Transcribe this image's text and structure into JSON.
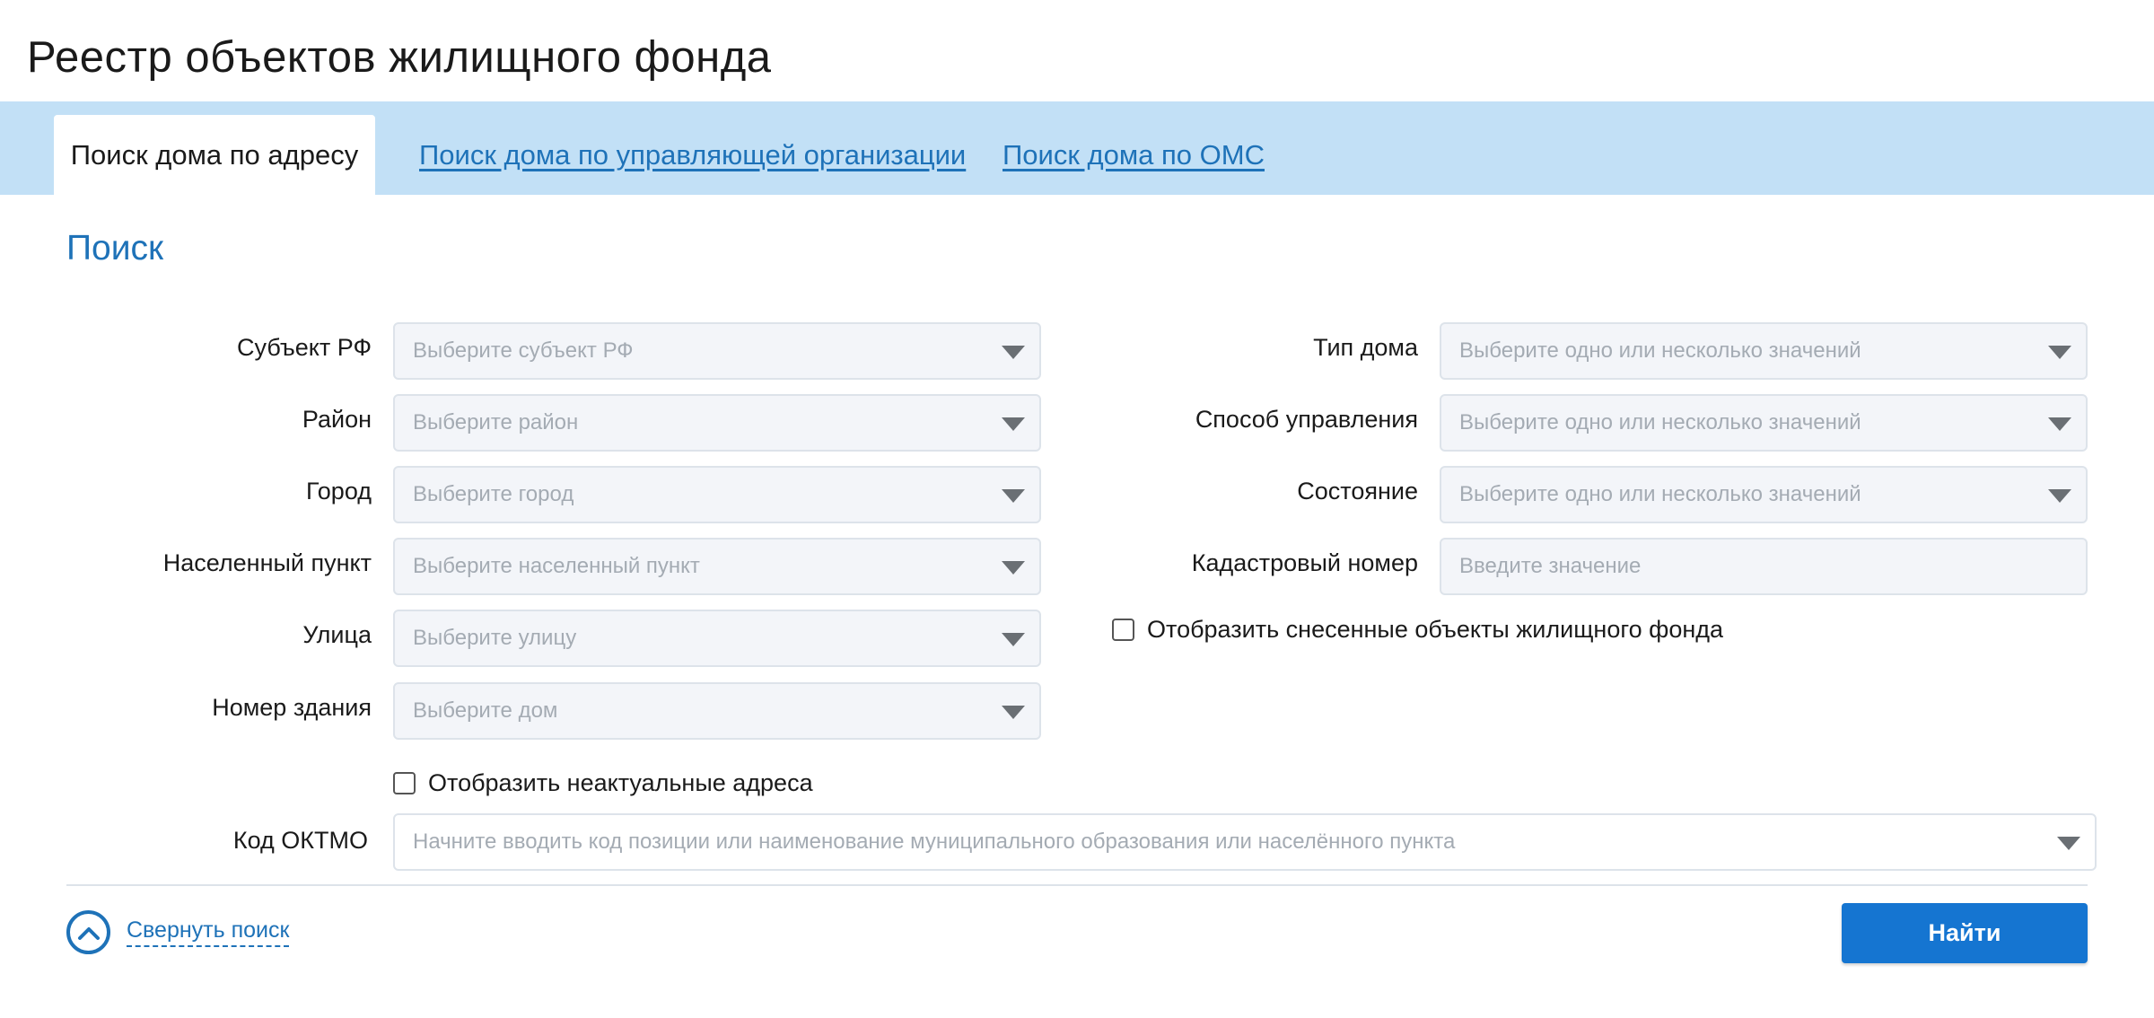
{
  "page": {
    "title": "Реестр объектов жилищного фонда"
  },
  "tabs": [
    {
      "label": "Поиск дома по адресу",
      "active": true
    },
    {
      "label": "Поиск дома по управляющей организации",
      "active": false
    },
    {
      "label": "Поиск дома по ОМС",
      "active": false
    }
  ],
  "search": {
    "title": "Поиск",
    "left_fields": [
      {
        "label": "Субъект РФ",
        "placeholder": "Выберите субъект РФ"
      },
      {
        "label": "Район",
        "placeholder": "Выберите район"
      },
      {
        "label": "Город",
        "placeholder": "Выберите город"
      },
      {
        "label": "Населенный пункт",
        "placeholder": "Выберите населенный пункт"
      },
      {
        "label": "Улица",
        "placeholder": "Выберите улицу"
      },
      {
        "label": "Номер здания",
        "placeholder": "Выберите дом"
      }
    ],
    "right_fields": [
      {
        "label": "Тип дома",
        "placeholder": "Выберите одно или несколько значений"
      },
      {
        "label": "Способ управления",
        "placeholder": "Выберите одно или несколько значений"
      },
      {
        "label": "Состояние",
        "placeholder": "Выберите одно или несколько значений"
      },
      {
        "label": "Кадастровый номер",
        "placeholder": "Введите значение"
      }
    ],
    "checkbox_demolished": {
      "label": "Отобразить снесенные объекты жилищного фонда",
      "checked": false
    },
    "checkbox_outdated": {
      "label": "Отобразить неактуальные адреса",
      "checked": false
    },
    "oktmo": {
      "label": "Код ОКТМО",
      "placeholder": "Начните вводить код позиции или наименование муниципального образования или населённого пункта"
    },
    "collapse_label": "Свернуть поиск",
    "find_label": "Найти"
  },
  "colors": {
    "accent": "#1e72b8",
    "tabbar": "#c2e0f6",
    "button": "#1575d1"
  }
}
